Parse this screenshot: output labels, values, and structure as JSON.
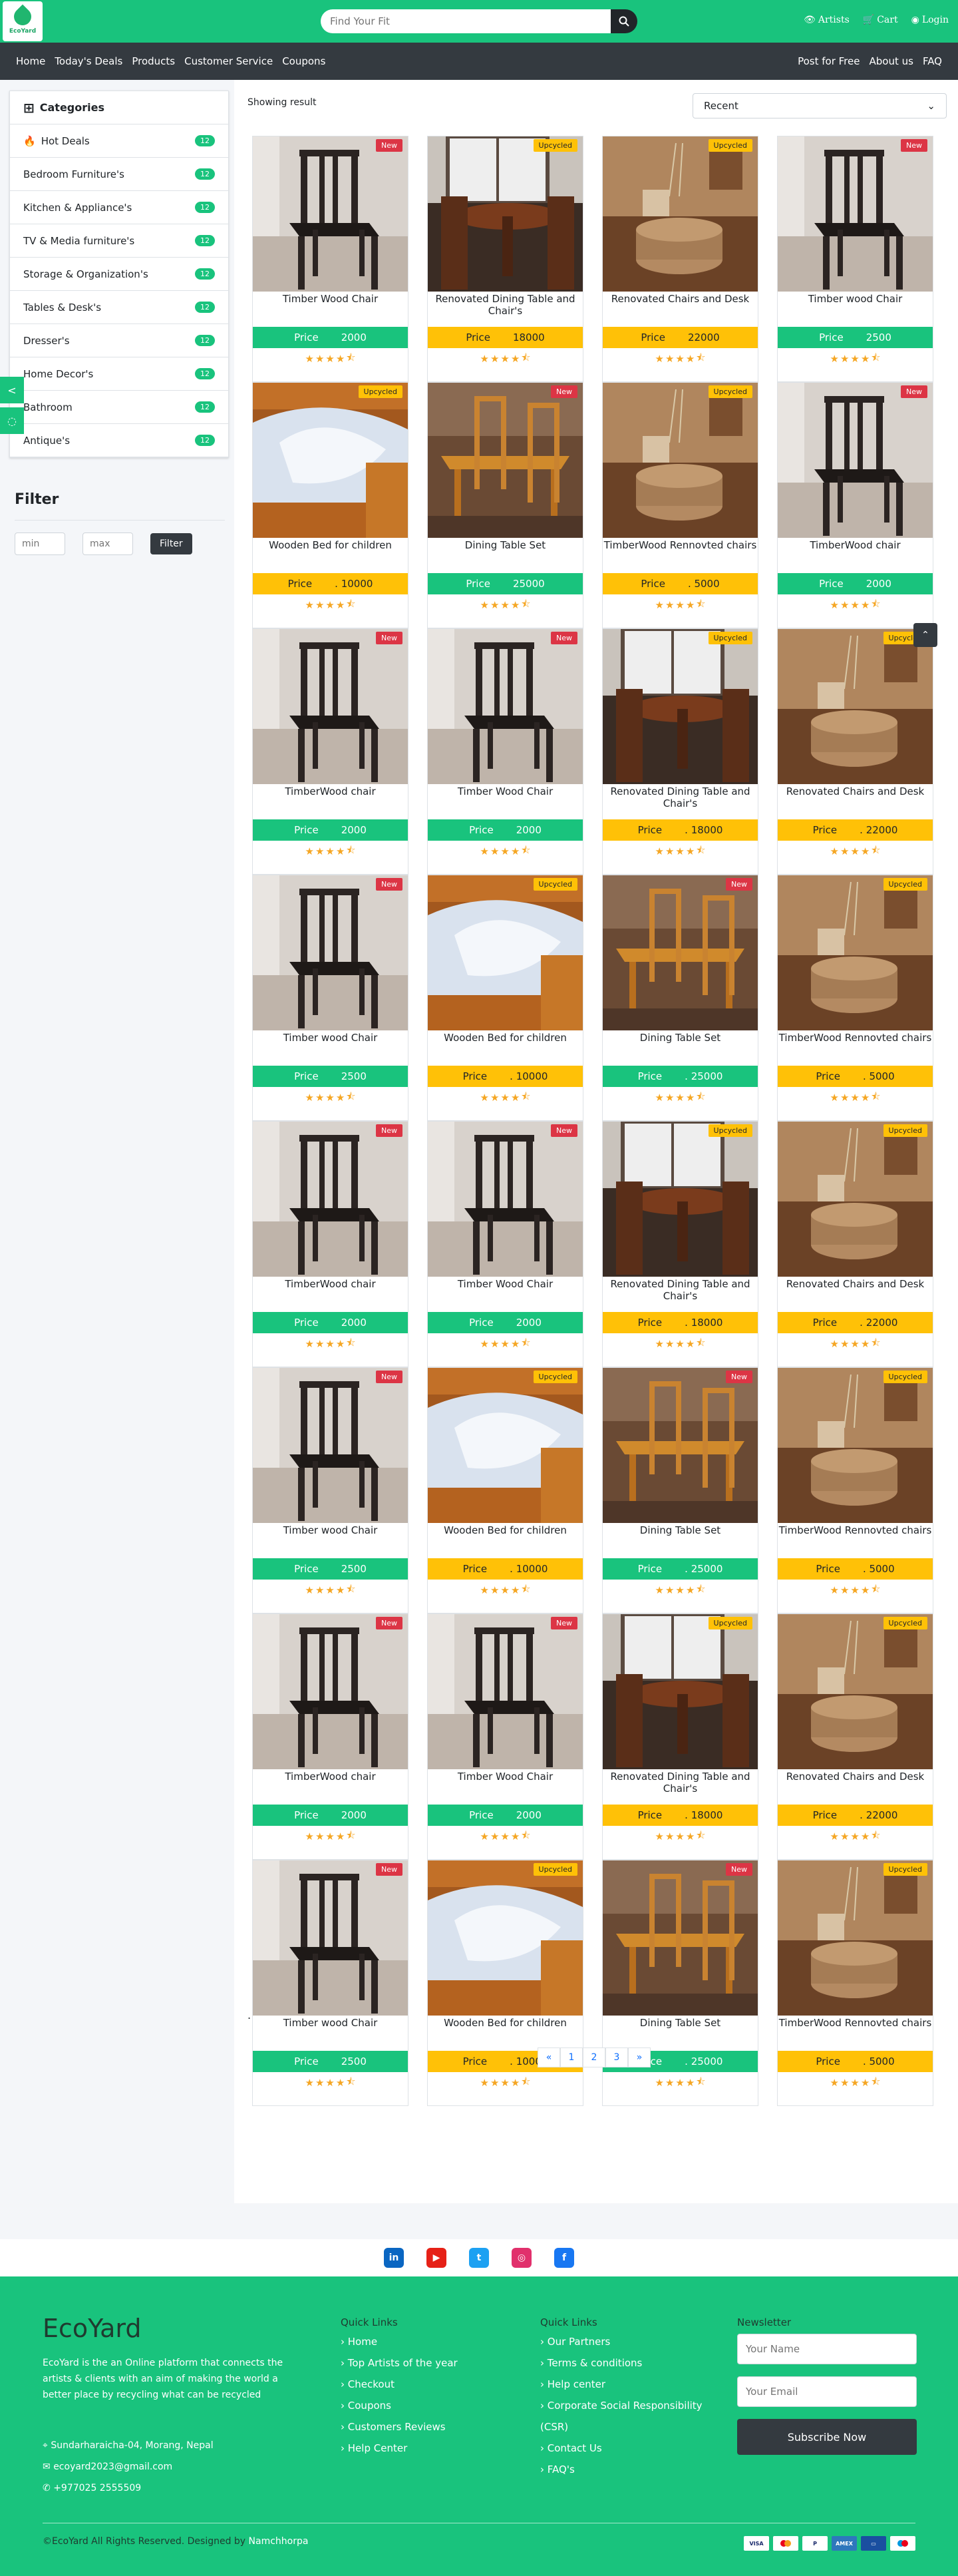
{
  "header": {
    "logo_text": "EcoYard",
    "search_placeholder": "Find Your Fit",
    "artists": "Artists",
    "cart": "Cart",
    "login": "Login"
  },
  "nav": {
    "left": [
      "Home",
      "Today's Deals",
      "Products",
      "Customer Service",
      "Coupons"
    ],
    "right": [
      "Post for Free",
      "About us",
      "FAQ"
    ]
  },
  "sidebar": {
    "title": "Categories",
    "items": [
      {
        "label": "Hot Deals",
        "count": "12"
      },
      {
        "label": "Bedroom Furniture's",
        "count": "12"
      },
      {
        "label": "Kitchen & Appliance's",
        "count": "12"
      },
      {
        "label": "TV & Media furniture's",
        "count": "12"
      },
      {
        "label": "Storage & Organization's",
        "count": "12"
      },
      {
        "label": "Tables & Desk's",
        "count": "12"
      },
      {
        "label": "Dresser's",
        "count": "12"
      },
      {
        "label": "Home Decor's",
        "count": "12"
      },
      {
        "label": "Bathroom",
        "count": "12"
      },
      {
        "label": "Antique's",
        "count": "12"
      }
    ],
    "filter": {
      "title": "Filter",
      "min_placeholder": "min",
      "max_placeholder": "max",
      "button": "Filter"
    }
  },
  "listing": {
    "showing": "Showing result",
    "sort_value": "Recent",
    "price_label": "Price",
    "dot": ".",
    "pages": [
      "«",
      "1",
      "2",
      "3",
      "»"
    ]
  },
  "products": [
    {
      "name": "Timber Wood Chair",
      "price": "2000",
      "tag": "New",
      "img": "chair"
    },
    {
      "name": "Renovated Dining Table and Chair's",
      "price": "18000",
      "tag": "Upcycled",
      "img": "dining"
    },
    {
      "name": "Renovated Chairs and Desk",
      "price": "22000",
      "tag": "Upcycled",
      "img": "desk"
    },
    {
      "name": "Timber wood Chair",
      "price": "2500",
      "tag": "New",
      "img": "chair"
    },
    {
      "name": "Wooden Bed for children",
      "price": ". 10000",
      "tag": "Upcycled",
      "img": "bed"
    },
    {
      "name": "Dining Table Set",
      "price": "25000",
      "tag": "New",
      "img": "table"
    },
    {
      "name": "TimberWood Rennovted chairs",
      "price": ". 5000",
      "tag": "Upcycled",
      "img": "desk"
    },
    {
      "name": "TimberWood chair",
      "price": "2000",
      "tag": "New",
      "img": "chair"
    },
    {
      "name": "TimberWood chair",
      "price": "2000",
      "tag": "New",
      "img": "chair"
    },
    {
      "name": "Timber Wood Chair",
      "price": "2000",
      "tag": "New",
      "img": "chair"
    },
    {
      "name": "Renovated Dining Table and Chair's",
      "price": ". 18000",
      "tag": "Upcycled",
      "img": "dining"
    },
    {
      "name": "Renovated Chairs and Desk",
      "price": ". 22000",
      "tag": "Upcycled",
      "img": "desk"
    },
    {
      "name": "Timber wood Chair",
      "price": "2500",
      "tag": "New",
      "img": "chair"
    },
    {
      "name": "Wooden Bed for children",
      "price": ". 10000",
      "tag": "Upcycled",
      "img": "bed"
    },
    {
      "name": "Dining Table Set",
      "price": ". 25000",
      "tag": "New",
      "img": "table"
    },
    {
      "name": "TimberWood Rennovted chairs",
      "price": ". 5000",
      "tag": "Upcycled",
      "img": "desk"
    },
    {
      "name": "TimberWood chair",
      "price": "2000",
      "tag": "New",
      "img": "chair"
    },
    {
      "name": "Timber Wood Chair",
      "price": "2000",
      "tag": "New",
      "img": "chair"
    },
    {
      "name": "Renovated Dining Table and Chair's",
      "price": ". 18000",
      "tag": "Upcycled",
      "img": "dining"
    },
    {
      "name": "Renovated Chairs and Desk",
      "price": ". 22000",
      "tag": "Upcycled",
      "img": "desk"
    },
    {
      "name": "Timber wood Chair",
      "price": "2500",
      "tag": "New",
      "img": "chair"
    },
    {
      "name": "Wooden Bed for children",
      "price": ". 10000",
      "tag": "Upcycled",
      "img": "bed"
    },
    {
      "name": "Dining Table Set",
      "price": ". 25000",
      "tag": "New",
      "img": "table"
    },
    {
      "name": "TimberWood Rennovted chairs",
      "price": ". 5000",
      "tag": "Upcycled",
      "img": "desk"
    },
    {
      "name": "TimberWood chair",
      "price": "2000",
      "tag": "New",
      "img": "chair"
    },
    {
      "name": "Timber Wood Chair",
      "price": "2000",
      "tag": "New",
      "img": "chair"
    },
    {
      "name": "Renovated Dining Table and Chair's",
      "price": ". 18000",
      "tag": "Upcycled",
      "img": "dining"
    },
    {
      "name": "Renovated Chairs and Desk",
      "price": ". 22000",
      "tag": "Upcycled",
      "img": "desk"
    },
    {
      "name": "Timber wood Chair",
      "price": "2500",
      "tag": "New",
      "img": "chair"
    },
    {
      "name": "Wooden Bed for children",
      "price": ". 10000",
      "tag": "Upcycled",
      "img": "bed"
    },
    {
      "name": "Dining Table Set",
      "price": ". 25000",
      "tag": "New",
      "img": "table"
    },
    {
      "name": "TimberWood Rennovted chairs",
      "price": ". 5000",
      "tag": "Upcycled",
      "img": "desk"
    }
  ],
  "footer": {
    "brand": "EcoYard",
    "description": "EcoYard is the an Online platform that connects the artists & clients with an aim of making the world a better place by recycling what can be recycled",
    "address": "Sundarharaicha-04, Morang, Nepal",
    "email": "ecoyard2023@gmail.com",
    "phone": "+977025 2555509",
    "col1": {
      "title": "Quick Links",
      "items": [
        "Home",
        "Top Artists of the year",
        "Checkout",
        "Coupons",
        "Customers Reviews",
        "Help Center"
      ]
    },
    "col2": {
      "title": "Quick Links",
      "items": [
        "Our Partners",
        "Terms & conditions",
        "Help center",
        "Corporate Social Responsibility (CSR)",
        "Contact Us",
        "FAQ's"
      ]
    },
    "newsletter": {
      "title": "Newsletter",
      "name_placeholder": "Your Name",
      "email_placeholder": "Your Email",
      "button": "Subscribe Now"
    },
    "copyright": "©EcoYard All Rights Reserved. Designed by ",
    "designer": "Namchhorpa"
  },
  "colors": {
    "brand": "#19c37d",
    "dark": "#343a40",
    "upcycled": "#ffc107",
    "new": "#dc3545"
  }
}
